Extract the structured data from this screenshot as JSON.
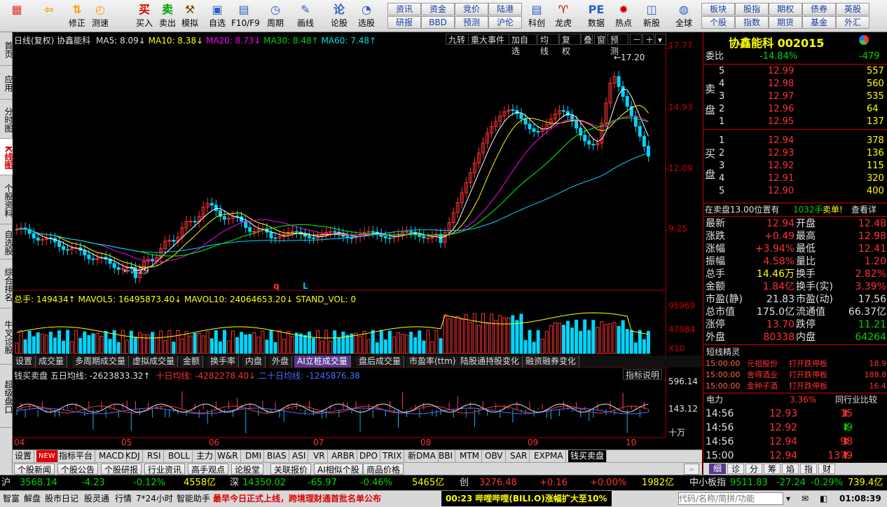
{
  "toolbar": {
    "items": [
      {
        "label": "",
        "icon": "app-grid-icon"
      },
      {
        "label": "",
        "icon": "back-arrow-icon"
      },
      {
        "label": "修正",
        "icon": "up-down-arrow-icon"
      },
      {
        "label": "测速",
        "icon": "speed-icon"
      },
      {
        "label": "买入",
        "icon": "buy-icon",
        "glyph": "买"
      },
      {
        "label": "卖出",
        "icon": "sell-icon",
        "glyph": "卖"
      },
      {
        "label": "模拟",
        "icon": "hammer-icon"
      },
      {
        "label": "自选",
        "icon": "folder-icon"
      },
      {
        "label": "F10/F9",
        "icon": "f10-icon"
      },
      {
        "label": "周期",
        "icon": "clock-icon"
      },
      {
        "label": "画线",
        "icon": "pen-icon"
      },
      {
        "label": "论股",
        "icon": "discuss-icon",
        "glyph": "论"
      },
      {
        "label": "选股",
        "icon": "select-stock-icon"
      },
      {
        "label": "科创",
        "icon": "star-market-icon"
      },
      {
        "label": "龙虎",
        "icon": "dragon-tiger-icon"
      },
      {
        "label": "数据",
        "icon": "data-pe-icon",
        "glyph": "PE"
      },
      {
        "label": "热点",
        "icon": "hot-icon"
      },
      {
        "label": "新股",
        "icon": "ipo-icon"
      },
      {
        "label": "全球",
        "icon": "globe-icon"
      }
    ],
    "small_buttons_1": [
      "资讯",
      "资金",
      "竞价",
      "陆港",
      "研报",
      "BBD",
      "预测",
      "沪伦"
    ],
    "small_buttons_2": [
      "板块",
      "股指",
      "期权",
      "债券",
      "英股",
      "个股",
      "指数",
      "期货",
      "基金",
      "外汇"
    ]
  },
  "leftnav": [
    "首页",
    "应用",
    "分时图",
    "K线图",
    "个股资料",
    "自选股",
    "综合排名",
    "牛叉诊股",
    "超级盘口"
  ],
  "kline": {
    "header_title": "日线(复权) 协鑫能科",
    "ma5": "MA5: 8.09↓",
    "ma10": "MA10: 8.38↓",
    "ma20": "MA20: 8.73↓",
    "ma30": "MA30: 8.48↑",
    "ma60": "MA60: 7.48↑",
    "buttons": [
      "九转",
      "重大事件",
      "加自选",
      "均线",
      "复权",
      "叠",
      "窗",
      "预测"
    ],
    "y_labels": [
      "17.77",
      "14.93",
      "12.09",
      "9.25"
    ],
    "high_label": "17.20",
    "low_label": "7.29",
    "marker_q": "q",
    "marker_l": "L"
  },
  "volume": {
    "header": "总手: 149434↑ MAVOL5: 16495873.40↓ MAVOL10: 24064653.20↓ STAND_VOL: 0",
    "y_labels": [
      "95969",
      "47984",
      "X10"
    ]
  },
  "tabs1": [
    "设置",
    "成交量",
    "多周期成交量",
    "虚拟成交量",
    "金额",
    "换手率",
    "内盘",
    "外盘",
    "AI立桩成交量",
    "盘后成交量",
    "市盈率(ttm)",
    "陆股通持股变化",
    "融资融券变化"
  ],
  "indicator": {
    "header_a": "钱买卖盘 五日均线: -2623833.32↑",
    "header_b": "十日均线: -4282278.40↓",
    "header_c": "二十日均线: -1245876.38",
    "explain_btn": "指标说明",
    "y_labels": [
      "596.14",
      "143.12",
      "十万"
    ]
  },
  "x_axis": [
    "04",
    "05",
    "06",
    "07",
    "08",
    "09",
    "10"
  ],
  "tabs2": [
    "设置",
    "NEW",
    "指标平台",
    "MACD",
    "KDJ",
    "RSI",
    "BOLL",
    "主力",
    "W&R",
    "DMI",
    "BIAS",
    "ASI",
    "VR",
    "ARBR",
    "DPO",
    "TRIX",
    "新DMA",
    "BBI",
    "MTM",
    "OBV",
    "SAR",
    "EXPMA",
    "钱买卖盘"
  ],
  "tabs3": [
    "个股新闻",
    "个股公告",
    "个股研报",
    "行业资讯",
    "高手观点",
    "论股堂",
    "关联报价",
    "AI相似个股",
    "商品价格"
  ],
  "right": {
    "stock_title": "协鑫能科 002015",
    "weibi_label": "委比",
    "weibi": "-14.84%",
    "weicha": "-479",
    "sell_side": "卖盘",
    "buy_side": "买盘",
    "asks": [
      {
        "n": "5",
        "p": "12.99",
        "v": "557"
      },
      {
        "n": "4",
        "p": "12.98",
        "v": "560"
      },
      {
        "n": "3",
        "p": "12.97",
        "v": "535"
      },
      {
        "n": "2",
        "p": "12.96",
        "v": "64"
      },
      {
        "n": "1",
        "p": "12.95",
        "v": "137"
      }
    ],
    "bids": [
      {
        "n": "1",
        "p": "12.94",
        "v": "378"
      },
      {
        "n": "2",
        "p": "12.93",
        "v": "136"
      },
      {
        "n": "3",
        "p": "12.92",
        "v": "115"
      },
      {
        "n": "4",
        "p": "12.91",
        "v": "320"
      },
      {
        "n": "5",
        "p": "12.90",
        "v": "400"
      }
    ],
    "notice_a": "在卖盘13.00位置有",
    "notice_b": "1032手",
    "notice_c": "卖单!",
    "notice_d": "查看详",
    "quote": [
      {
        "l1": "最新",
        "v1": "12.94",
        "l2": "开盘",
        "v2": "12.48"
      },
      {
        "l1": "涨跌",
        "v1": "+0.49",
        "l2": "最高",
        "v2": "12.98"
      },
      {
        "l1": "涨幅",
        "v1": "+3.94%",
        "l2": "最低",
        "v2": "12.41"
      },
      {
        "l1": "振幅",
        "v1": "4.58%",
        "l2": "量比",
        "v2": "1.20"
      },
      {
        "l1": "总手",
        "v1": "14.46万",
        "l2": "换手",
        "v2": "2.82%"
      },
      {
        "l1": "金额",
        "v1": "1.84亿",
        "l2": "换手(实)",
        "v2": "3.39%"
      },
      {
        "l1": "市盈(静)",
        "v1": "21.83",
        "l2": "市盈(动)",
        "v2": "17.56"
      },
      {
        "l1": "总市值",
        "v1": "175.0亿",
        "l2": "流通值",
        "v2": "66.37亿"
      },
      {
        "l1": "涨停",
        "v1": "13.70",
        "l2": "跌停",
        "v2": "11.21"
      },
      {
        "l1": "外盘",
        "v1": "80338",
        "l2": "内盘",
        "v2": "64264"
      }
    ],
    "sprite_title": "短线精灵",
    "sprites": [
      {
        "t": "15:00:00",
        "n": "元祖股份",
        "e": "打开跌停板",
        "v": "18.9"
      },
      {
        "t": "15:00:00",
        "n": "舍得酒业",
        "e": "打开跌停板",
        "v": "188.8"
      },
      {
        "t": "15:00:00",
        "n": "金种子酒",
        "e": "打开跌停板",
        "v": "16.4"
      }
    ],
    "industry": "电力",
    "industry_pct": "3.36%",
    "industry_btn": "同行业比较",
    "ticks": [
      {
        "t": "14:56",
        "p": "12.93",
        "v": "15"
      },
      {
        "t": "14:56",
        "p": "12.92",
        "v": "9"
      },
      {
        "t": "14:56",
        "p": "12.94",
        "v": "98"
      },
      {
        "t": "15:00",
        "p": "12.94",
        "v": "1379"
      }
    ],
    "tabs": [
      "细",
      "诊",
      "分",
      "筹",
      "焰",
      "指",
      "财"
    ]
  },
  "status": {
    "sh_label": "沪",
    "sh": "3568.14",
    "sh_chg": "-4.23",
    "sh_pct": "-0.12%",
    "sh_amt": "4558亿",
    "sz_label": "深",
    "sz": "14350.02",
    "sz_chg": "-65.97",
    "sz_pct": "-0.46%",
    "sz_amt": "5465亿",
    "cy_label": "创",
    "cy": "3276.48",
    "cy_chg": "+0.16",
    "cy_pct": "+0.00%",
    "cy_amt": "1982亿",
    "zx_label": "中小板指",
    "zx": "9511.83",
    "zx_chg": "-27.24",
    "zx_pct": "-0.29%",
    "zx_amt": "739.4亿"
  },
  "bottom": {
    "items": [
      "智富",
      "解盘",
      "股市日记",
      "股灵通",
      "行情",
      "7*24小时",
      "智能助手"
    ],
    "news": "最早今日正式上线，跨境理财通首批名单公布",
    "news2": "00:23 哔哩哔哩(BILI.O)涨幅扩大至10%",
    "search_placeholder": "代码/名称/简拼/功能",
    "clock": "01:08:39"
  },
  "colors": {
    "up": "#ff3232",
    "down": "#00d6ff",
    "ma5": "#ffffff",
    "ma10": "#ffff00",
    "ma20": "#ff00ff",
    "ma30": "#00ff00",
    "ma60": "#00d6ff"
  }
}
